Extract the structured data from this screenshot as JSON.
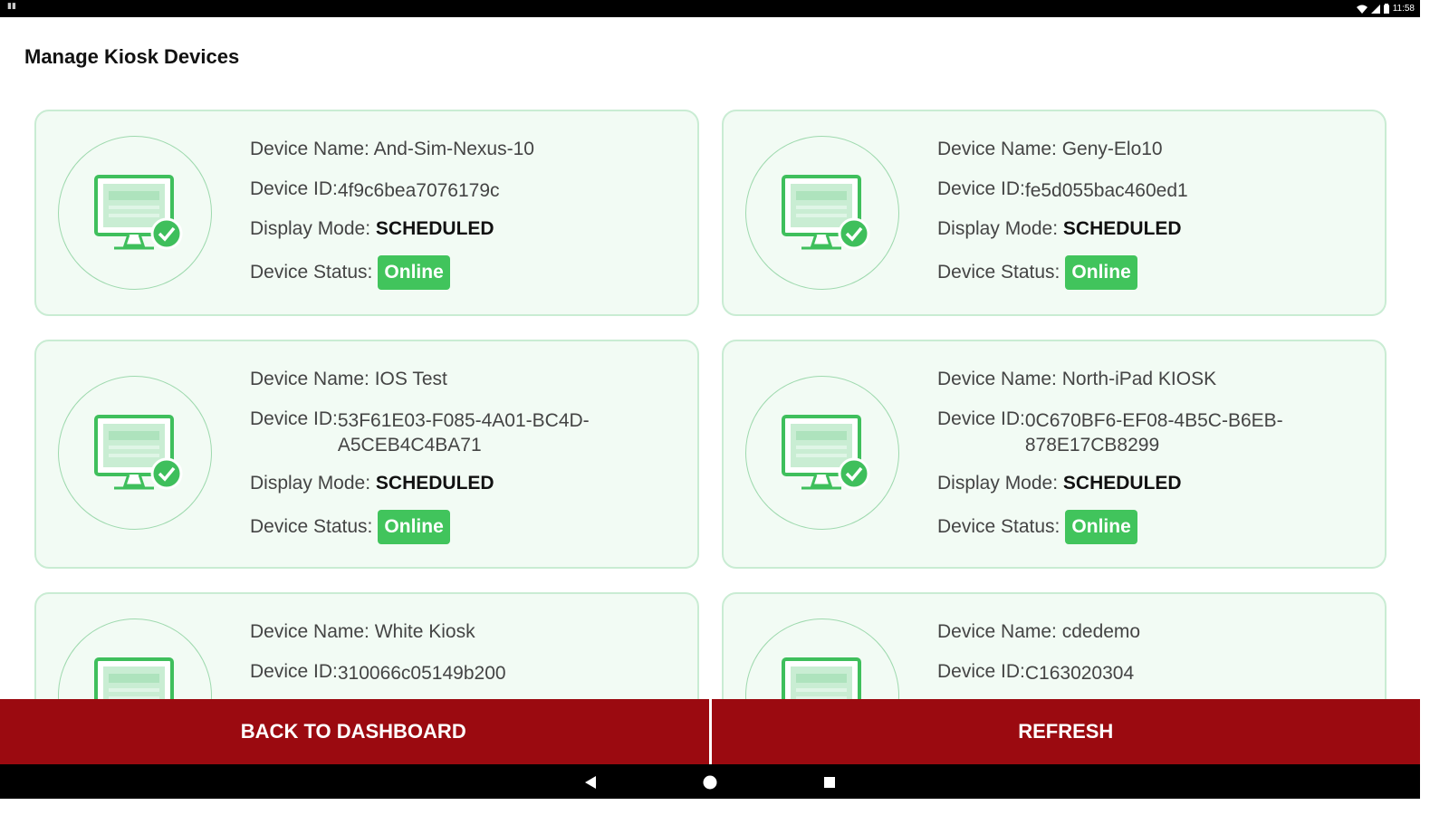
{
  "status_bar": {
    "notification": "▮▮",
    "time": "11:58"
  },
  "page": {
    "title": "Manage Kiosk Devices"
  },
  "labels": {
    "device_name": "Device Name: ",
    "device_id": "Device ID: ",
    "display_mode": "Display Mode: ",
    "device_status": "Device Status: "
  },
  "devices": [
    {
      "name": "And-Sim-Nexus-10",
      "id": "4f9c6bea7076179c",
      "mode": "SCHEDULED",
      "status": "Online"
    },
    {
      "name": "Geny-Elo10",
      "id": "fe5d055bac460ed1",
      "mode": "SCHEDULED",
      "status": "Online"
    },
    {
      "name": "IOS Test",
      "id": "53F61E03-F085-4A01-BC4D-A5CEB4C4BA71",
      "mode": "SCHEDULED",
      "status": "Online"
    },
    {
      "name": "North-iPad KIOSK",
      "id": "0C670BF6-EF08-4B5C-B6EB-878E17CB8299",
      "mode": "SCHEDULED",
      "status": "Online"
    },
    {
      "name": "White Kiosk",
      "id": "310066c05149b200"
    },
    {
      "name": "cdedemo",
      "id": "C163020304"
    }
  ],
  "actions": {
    "back": "BACK TO DASHBOARD",
    "refresh": "REFRESH"
  },
  "colors": {
    "accent_red": "#9b0a10",
    "status_green": "#41c45c",
    "card_bg": "#f2fbf4"
  }
}
